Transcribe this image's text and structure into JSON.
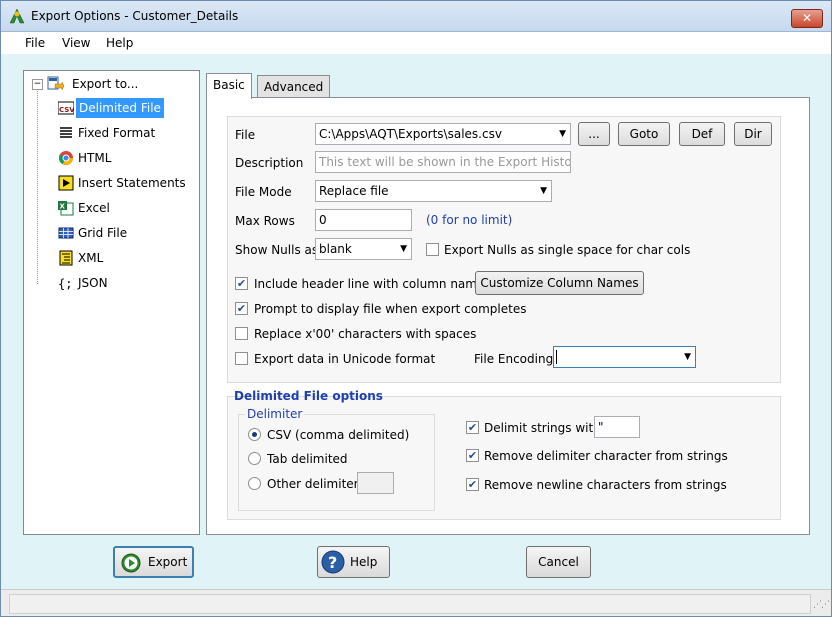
{
  "window": {
    "title": "Export Options - Customer_Details",
    "close_label": "✕"
  },
  "menu": {
    "file": "File",
    "view": "View",
    "help": "Help"
  },
  "tree": {
    "root": "Export to...",
    "items": [
      {
        "label": "Delimited File",
        "icon": "csv-icon",
        "selected": true
      },
      {
        "label": "Fixed Format",
        "icon": "fixed-format-icon"
      },
      {
        "label": "HTML",
        "icon": "html-icon"
      },
      {
        "label": "Insert Statements",
        "icon": "insert-statements-icon"
      },
      {
        "label": "Excel",
        "icon": "excel-icon"
      },
      {
        "label": "Grid File",
        "icon": "grid-file-icon"
      },
      {
        "label": "XML",
        "icon": "xml-icon"
      },
      {
        "label": "JSON",
        "icon": "json-icon"
      }
    ]
  },
  "tabs": {
    "basic": "Basic",
    "advanced": "Advanced"
  },
  "form": {
    "file_label": "File",
    "file_value": "C:\\Apps\\AQT\\Exports\\sales.csv",
    "browse_label": "...",
    "goto_label": "Goto",
    "def_label": "Def",
    "dir_label": "Dir",
    "description_label": "Description",
    "description_placeholder": "This text will be shown in the Export History",
    "file_mode_label": "File Mode",
    "file_mode_value": "Replace file",
    "max_rows_label": "Max Rows",
    "max_rows_value": "0",
    "max_rows_hint": "(0 for no limit)",
    "show_nulls_label": "Show Nulls as",
    "show_nulls_value": "blank",
    "export_nulls_label": "Export Nulls as single space for char cols",
    "include_header_label": "Include header line with column names",
    "customize_columns_label": "Customize Column Names",
    "prompt_display_label": "Prompt to display file when export completes",
    "replace_x00_label": "Replace x'00' characters with spaces",
    "unicode_label": "Export data in Unicode format",
    "file_encoding_label": "File Encoding",
    "file_encoding_value": ""
  },
  "checks": {
    "export_nulls": false,
    "include_header": true,
    "prompt_display": true,
    "replace_x00": false,
    "unicode": false,
    "delimit_strings": true,
    "remove_delimiter": true,
    "remove_newline": true
  },
  "delimited": {
    "section_title": "Delimited File options",
    "delimiter_group": "Delimiter",
    "csv_label": "CSV (comma delimited)",
    "tab_label": "Tab delimited",
    "other_label": "Other delimiter",
    "selected_delimiter": "csv",
    "delimit_strings_label": "Delimit strings with",
    "delimit_strings_value": "\"",
    "remove_delimiter_label": "Remove delimiter character from strings",
    "remove_newline_label": "Remove newline characters from strings"
  },
  "buttons": {
    "export": "Export",
    "help": "Help",
    "cancel": "Cancel"
  },
  "colors": {
    "background": "#e0f4f8",
    "selection": "#3399ff",
    "accent_text": "#1f3fb0"
  }
}
